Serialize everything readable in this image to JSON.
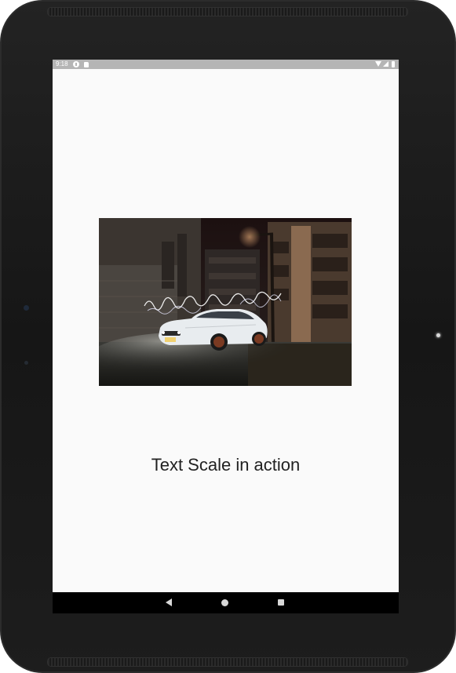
{
  "status_bar": {
    "time": "9:18",
    "icons": [
      "notification-circle-icon",
      "sd-card-icon",
      "wifi-icon",
      "signal-icon",
      "battery-icon"
    ]
  },
  "main": {
    "image_alt": "White muscle car parked at night with light painting",
    "caption": "Text Scale in action"
  },
  "nav_bar": {
    "icons": [
      "back-icon",
      "home-icon",
      "recents-icon"
    ]
  },
  "colors": {
    "screen_background": "#fafafa",
    "status_bar": "#b5b5b5",
    "nav_bar": "#000000",
    "caption_text": "#222222"
  }
}
